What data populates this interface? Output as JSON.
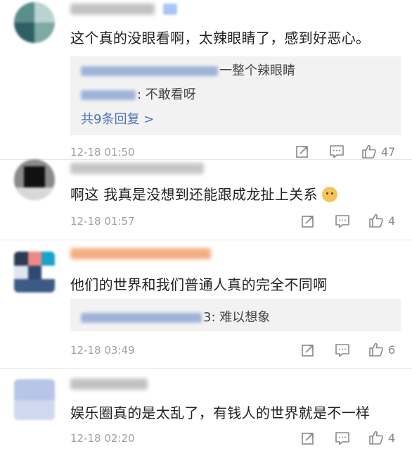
{
  "comments": [
    {
      "text": "这个真的没眼看啊，太辣眼睛了，感到好恶心。",
      "replies": [
        {
          "text": "一整个辣眼睛"
        },
        {
          "text": ": 不敢看呀"
        }
      ],
      "more": "共9条回复 >",
      "time": "12-18 01:50",
      "likes": "47"
    },
    {
      "text": "啊这 我真是没想到还能跟成龙扯上关系",
      "time": "12-18 01:57",
      "likes": "4"
    },
    {
      "text": "他们的世界和我们普通人真的完全不同啊",
      "replies": [
        {
          "text": "3: 难以想象"
        }
      ],
      "time": "12-18 03:49",
      "likes": "6"
    },
    {
      "text": "娱乐圈真的是太乱了，有钱人的世界就是不一样",
      "time": "12-18 02:20",
      "likes": "4"
    }
  ],
  "icons": {
    "share": "share-icon",
    "comment": "comment-icon",
    "like": "thumbs-up-icon",
    "emoji": "doge-emoji-icon"
  },
  "colors": {
    "link": "#4e73b5",
    "time": "#a0a0a0",
    "reply_bg": "#f2f2f2",
    "username_orange": "#f0a070"
  }
}
